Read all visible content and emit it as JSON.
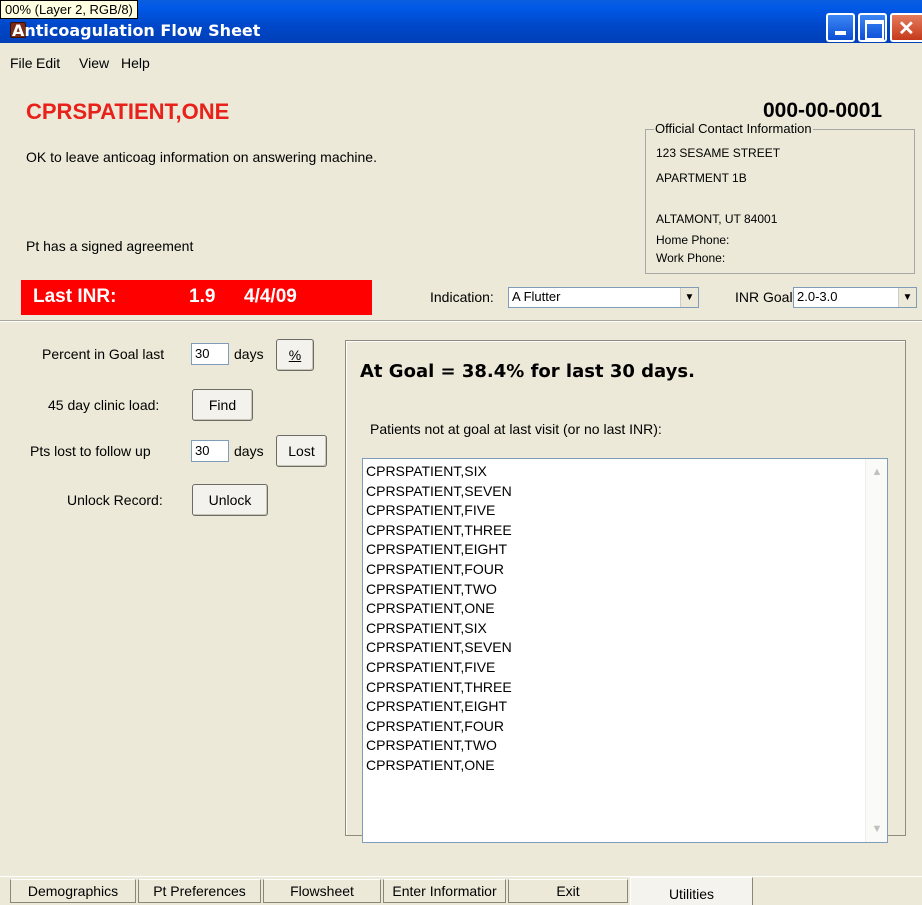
{
  "window": {
    "title": "Anticoagulation Flow Sheet",
    "layer_tag": "00% (Layer 2, RGB/8)"
  },
  "menu": [
    "File",
    "Edit",
    "View",
    "Help"
  ],
  "patient": {
    "name": "CPRSPATIENT,ONE",
    "ssn": "000-00-0001",
    "note_answering_machine": "OK to leave anticoag information on answering machine.",
    "note_agreement": "Pt has a signed agreement"
  },
  "contact": {
    "legend": "Official Contact Information",
    "line1": "123 SESAME STREET",
    "line2": "APARTMENT 1B",
    "line3": "ALTAMONT, UT 84001",
    "home_phone": "Home Phone:",
    "work_phone": "Work Phone:"
  },
  "inr": {
    "label": "Last INR:",
    "value": "1.9",
    "date": "4/4/09"
  },
  "indication": {
    "label": "Indication:",
    "value": "A Flutter"
  },
  "inr_goal": {
    "label": "INR Goal:",
    "value": "2.0-3.0"
  },
  "utilities": {
    "percent_label": "Percent in Goal last",
    "percent_days": "30",
    "days_label": "days",
    "percent_button": "%",
    "clinic_load_label": "45 day clinic load:",
    "find_button": "Find",
    "lost_label": "Pts lost to follow up",
    "lost_days": "30",
    "lost_days_label": "days",
    "lost_button": "Lost",
    "unlock_label": "Unlock Record:",
    "unlock_button": "Unlock"
  },
  "result": {
    "title": "At Goal = 38.4% for last 30 days.",
    "subtitle": "Patients not at goal at last visit (or no last INR):",
    "patients": [
      "CPRSPATIENT,SIX",
      "CPRSPATIENT,SEVEN",
      "CPRSPATIENT,FIVE",
      "CPRSPATIENT,THREE",
      "CPRSPATIENT,EIGHT",
      "CPRSPATIENT,FOUR",
      "CPRSPATIENT,TWO",
      "CPRSPATIENT,ONE",
      "CPRSPATIENT,SIX",
      "CPRSPATIENT,SEVEN",
      "CPRSPATIENT,FIVE",
      "CPRSPATIENT,THREE",
      "CPRSPATIENT,EIGHT",
      "CPRSPATIENT,FOUR",
      "CPRSPATIENT,TWO",
      "CPRSPATIENT,ONE"
    ]
  },
  "tabs": [
    "Demographics",
    "Pt Preferences",
    "Flowsheet",
    "Enter Informatior",
    "Exit",
    "Utilities"
  ],
  "active_tab": "Utilities"
}
